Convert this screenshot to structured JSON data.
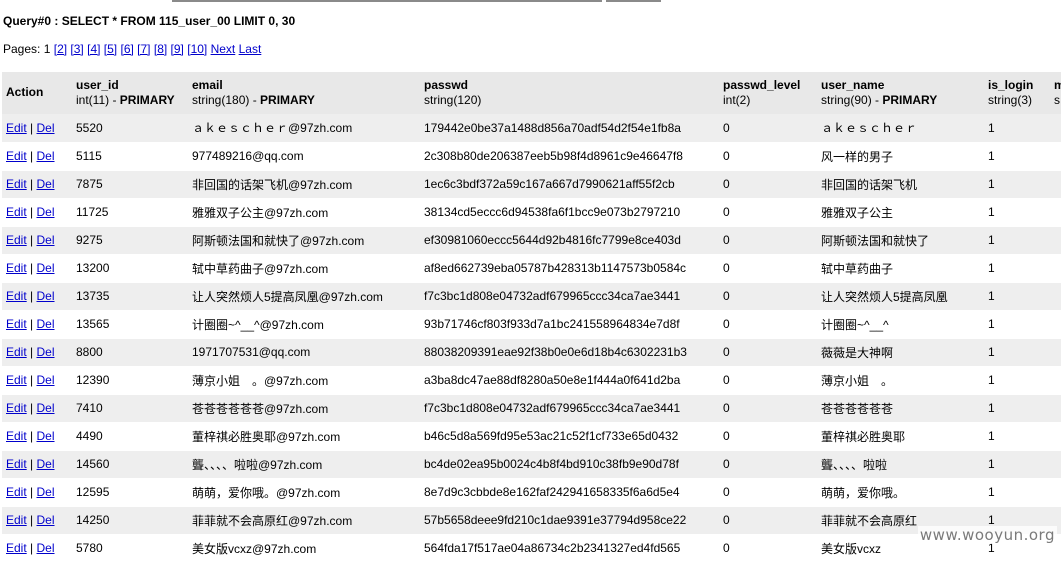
{
  "query": "Query#0 : SELECT * FROM 115_user_00 LIMIT 0, 30",
  "pages": {
    "label": "Pages:",
    "current": "1",
    "links": [
      "[2]",
      "[3]",
      "[4]",
      "[5]",
      "[6]",
      "[7]",
      "[8]",
      "[9]",
      "[10]"
    ],
    "next": "Next",
    "last": "Last"
  },
  "table": {
    "action_header": "Action",
    "columns": [
      {
        "name": "user_id",
        "type": "int(11)",
        "key": "PRIMARY"
      },
      {
        "name": "email",
        "type": "string(180)",
        "key": "PRIMARY"
      },
      {
        "name": "passwd",
        "type": "string(120)",
        "key": ""
      },
      {
        "name": "passwd_level",
        "type": "int(2)",
        "key": ""
      },
      {
        "name": "user_name",
        "type": "string(90)",
        "key": "PRIMARY"
      },
      {
        "name": "is_login",
        "type": "string(3)",
        "key": ""
      },
      {
        "name": "m",
        "type": "s",
        "key": ""
      }
    ],
    "edit_label": "Edit",
    "separator": "|",
    "del_label": "Del",
    "rows": [
      [
        "5520",
        "ａｋｅｓｃｈｅｒ@97zh.com",
        "179442e0be37a1488d856a70adf54d2f54e1fb8a",
        "0",
        "ａｋｅｓｃｈｅｒ",
        "1"
      ],
      [
        "5115",
        "977489216@qq.com",
        "2c308b80de206387eeb5b98f4d8961c9e46647f8",
        "0",
        "风一样的男子",
        "1"
      ],
      [
        "7875",
        "非回国的话架飞机@97zh.com",
        "1ec6c3bdf372a59c167a667d7990621aff55f2cb",
        "0",
        "非回国的话架飞机",
        "1"
      ],
      [
        "11725",
        "雅雅双子公主@97zh.com",
        "38134cd5eccc6d94538fa6f1bcc9e073b2797210",
        "0",
        "雅雅双子公主",
        "1"
      ],
      [
        "9275",
        "阿斯顿法国和就快了@97zh.com",
        "ef30981060eccc5644d92b4816fc7799e8ce403d",
        "0",
        "阿斯顿法国和就快了",
        "1"
      ],
      [
        "13200",
        "轼中草药曲子@97zh.com",
        "af8ed662739eba05787b428313b1147573b0584c",
        "0",
        "轼中草药曲子",
        "1"
      ],
      [
        "13735",
        "让人突然烦人5提高凤凰@97zh.com",
        "f7c3bc1d808e04732adf679965ccc34ca7ae3441",
        "0",
        "让人突然烦人5提高凤凰",
        "1"
      ],
      [
        "13565",
        "计圈圈~^__^@97zh.com",
        "93b71746cf803f933d7a1bc241558964834e7d8f",
        "0",
        "计圈圈~^__^",
        "1"
      ],
      [
        "8800",
        "1971707531@qq.com",
        "88038209391eae92f38b0e0e6d18b4c6302231b3",
        "0",
        "薇薇是大神啊",
        "1"
      ],
      [
        "12390",
        "薄京小姐　。@97zh.com",
        "a3ba8dc47ae88df8280a50e8e1f444a0f641d2ba",
        "0",
        "薄京小姐　。",
        "1"
      ],
      [
        "7410",
        "苍苍苍苍苍苍@97zh.com",
        "f7c3bc1d808e04732adf679965ccc34ca7ae3441",
        "0",
        "苍苍苍苍苍苍",
        "1"
      ],
      [
        "4490",
        "董梓祺必胜奥耶@97zh.com",
        "b46c5d8a569fd95e53ac21c52f1cf733e65d0432",
        "0",
        "董梓祺必胜奥耶",
        "1"
      ],
      [
        "14560",
        "聾、、、、啦啦@97zh.com",
        "bc4de02ea95b0024c4b8f4bd910c38fb9e90d78f",
        "0",
        "聾、、、、啦啦",
        "1"
      ],
      [
        "12595",
        "萌萌，爱你哦。@97zh.com",
        "8e7d9c3cbbde8e162faf242941658335f6a6d5e4",
        "0",
        "萌萌，爱你哦。",
        "1"
      ],
      [
        "14250",
        "菲菲就不会高原红@97zh.com",
        "57b5658deee9fd210c1dae9391e37794d958ce22",
        "0",
        "菲菲就不会高原红",
        "1"
      ],
      [
        "5780",
        "美女版vcxz@97zh.com",
        "564fda17f517ae04a86734c2b2341327ed4fd565",
        "0",
        "美女版vcxz",
        "1"
      ]
    ]
  },
  "watermark": "www.wooyun.org"
}
